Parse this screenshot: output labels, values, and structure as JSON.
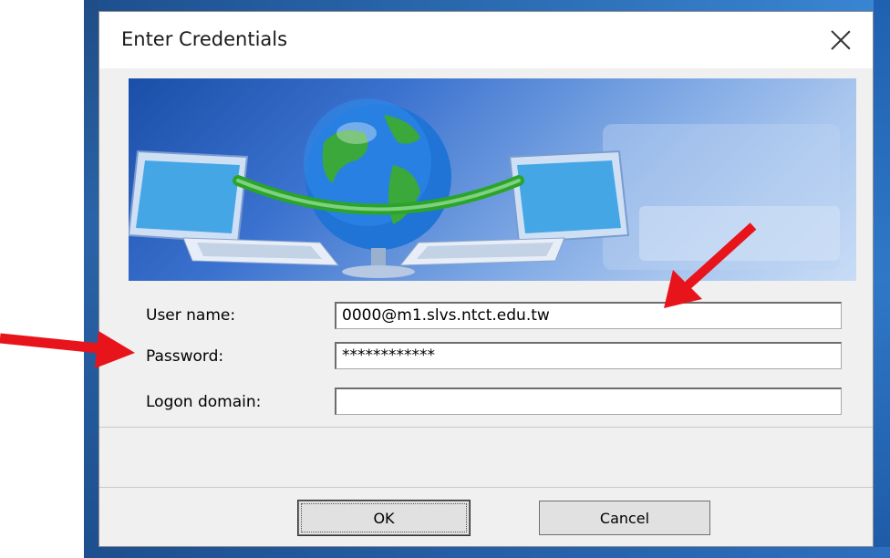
{
  "dialog": {
    "title": "Enter Credentials",
    "close_icon": "close-icon"
  },
  "form": {
    "username_label": "User name:",
    "username_value": "0000@m1.slvs.ntct.edu.tw",
    "password_label": "Password:",
    "password_value": "************",
    "domain_label": "Logon domain:",
    "domain_value": ""
  },
  "buttons": {
    "ok": "OK",
    "cancel": "Cancel"
  },
  "annotations": {
    "arrow_color": "#e8141b"
  }
}
